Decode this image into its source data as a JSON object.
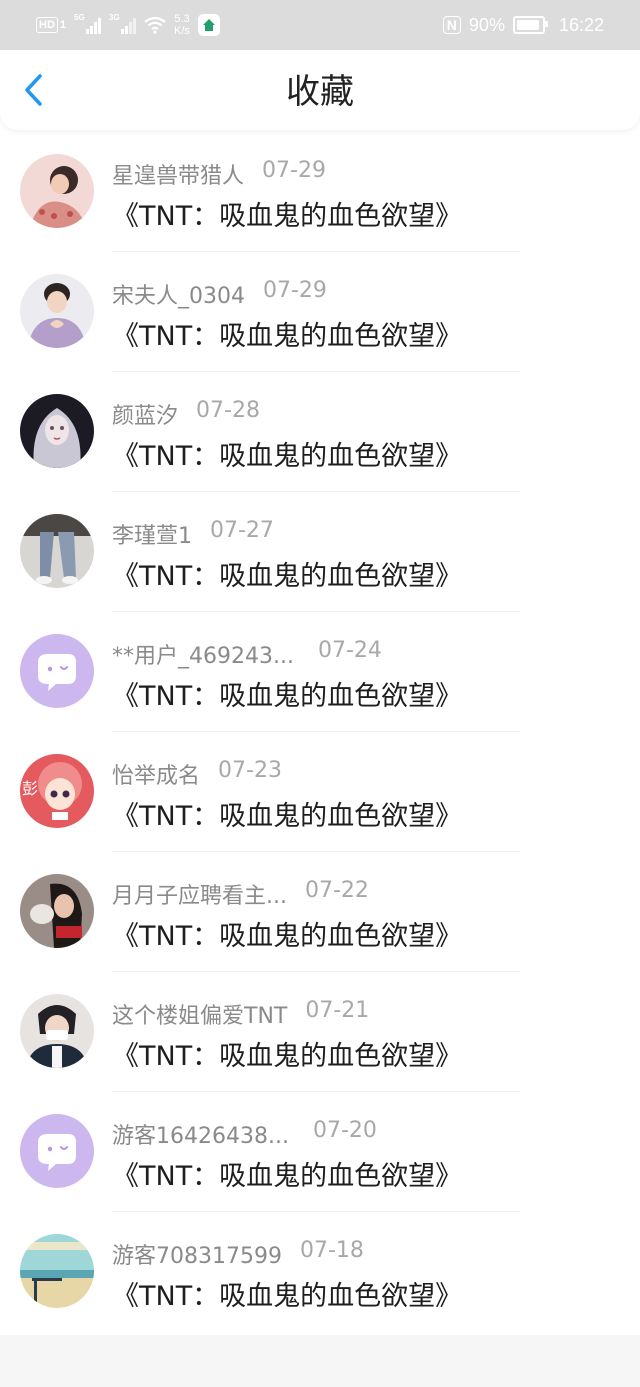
{
  "status_bar": {
    "hd": "HD",
    "sim_a": "1",
    "net_a": "5G",
    "net_b": "3G",
    "speed_value": "5.3",
    "speed_unit": "K/s",
    "nfc": "N",
    "battery_text": "90%",
    "time": "16:22",
    "battery_level": 0.9
  },
  "header": {
    "back_icon": "chevron-left-icon",
    "title": "收藏",
    "accent_color": "#2196f3"
  },
  "favorites": [
    {
      "user": "星遑兽带猎人",
      "date": "07-29",
      "title": "《TNT：吸血鬼的血色欲望》",
      "avatar": "photo-girl-pink"
    },
    {
      "user": "宋夫人_0304",
      "date": "07-29",
      "title": "《TNT：吸血鬼的血色欲望》",
      "avatar": "photo-boy-heart"
    },
    {
      "user": "颜蓝汐",
      "date": "07-28",
      "title": "《TNT：吸血鬼的血色欲望》",
      "avatar": "illustration-silver-hair"
    },
    {
      "user": "李瑾萱1",
      "date": "07-27",
      "title": "《TNT：吸血鬼的血色欲望》",
      "avatar": "photo-legs-jeans"
    },
    {
      "user": "**用户_469243...",
      "date": "07-24",
      "title": "《TNT：吸血鬼的血色欲望》",
      "avatar": "default-chat-bubble"
    },
    {
      "user": "怡举成名",
      "date": "07-23",
      "title": "《TNT：吸血鬼的血色欲望》",
      "avatar": "cartoon-girl-red"
    },
    {
      "user": "月月子应聘看主...",
      "date": "07-22",
      "title": "《TNT：吸血鬼的血色欲望》",
      "avatar": "photo-girl-cat"
    },
    {
      "user": "这个楼姐偏爱TNT",
      "date": "07-21",
      "title": "《TNT：吸血鬼的血色欲望》",
      "avatar": "photo-boy-mask"
    },
    {
      "user": "游客16426438...",
      "date": "07-20",
      "title": "《TNT：吸血鬼的血色欲望》",
      "avatar": "default-chat-bubble"
    },
    {
      "user": "游客708317599",
      "date": "07-18",
      "title": "《TNT：吸血鬼的血色欲望》",
      "avatar": "photo-seaside"
    }
  ]
}
